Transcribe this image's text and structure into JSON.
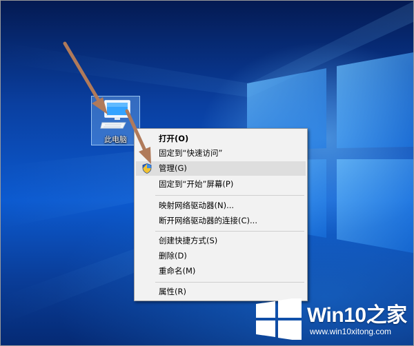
{
  "desktop": {
    "icon_label": "此电脑",
    "icon_name": "computer-icon"
  },
  "context_menu": {
    "items": [
      {
        "label": "打开(O)",
        "bold": true
      },
      {
        "label": "固定到“快速访问”"
      },
      {
        "label": "管理(G)",
        "highlighted": true,
        "icon": "uac-shield-icon"
      },
      {
        "label": "固定到“开始”屏幕(P)"
      },
      {
        "label": "映射网络驱动器(N)..."
      },
      {
        "label": "断开网络驱动器的连接(C)..."
      },
      {
        "label": "创建快捷方式(S)"
      },
      {
        "label": "删除(D)"
      },
      {
        "label": "重命名(M)"
      },
      {
        "label": "属性(R)"
      }
    ]
  },
  "annotations": {
    "arrow_color": "#b07a5a"
  },
  "watermark": {
    "brand": "Win10之家",
    "url": "www.win10xitong.com"
  },
  "colors": {
    "menu_background": "#f2f2f2",
    "menu_highlight": "#dedede",
    "wallpaper_blue": "#0c5ad0"
  }
}
